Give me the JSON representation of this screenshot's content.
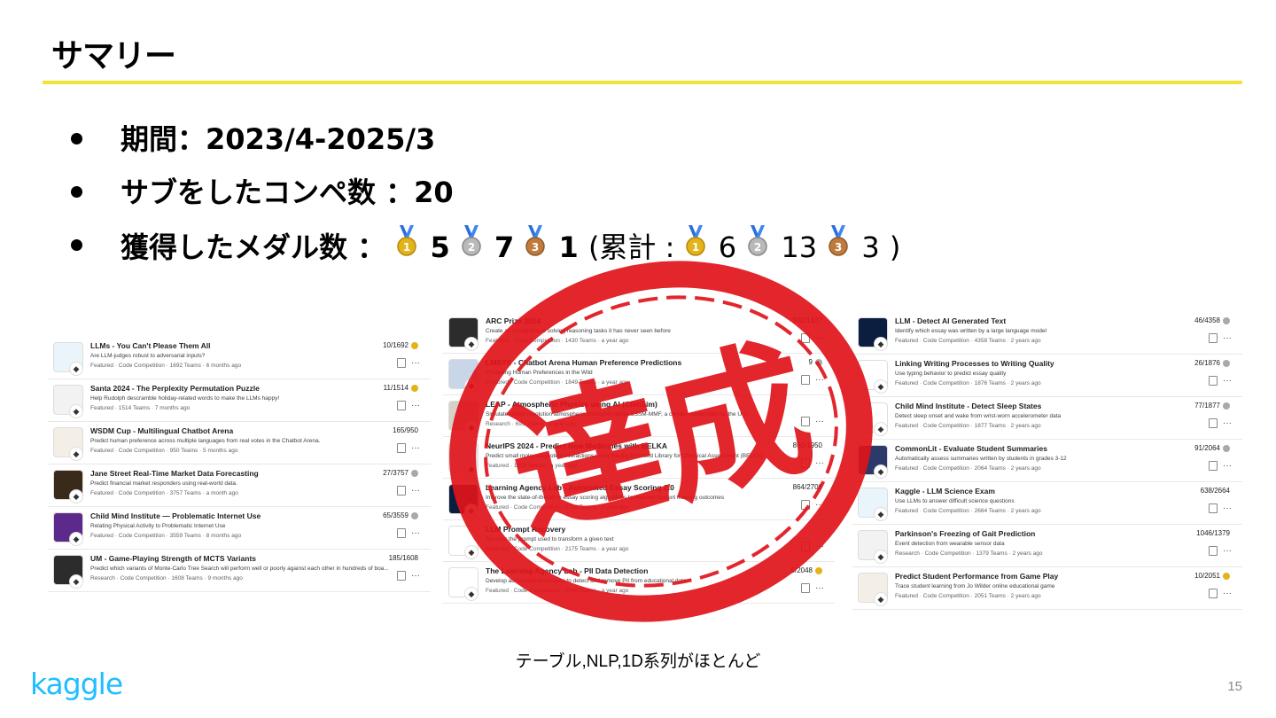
{
  "slide": {
    "title": "サマリー",
    "bullets": [
      {
        "label": "期間：2023/4-2025/3"
      },
      {
        "label": "サブをしたコンペ数 ：20"
      },
      {
        "label": "獲得したメダル数 ：",
        "gold": "5",
        "silver": "7",
        "bronze": "1",
        "total_prefix": "(累計 : ",
        "total_gold": "6",
        "total_silver": "13",
        "total_bronze": "3",
        "total_suffix": ")"
      }
    ],
    "caption": "テーブル,NLP,1D系列がほとんど",
    "logo": "kaggle",
    "page_number": "15",
    "stamp_text": "達成",
    "colors": {
      "accent_rule": "#f2e23a",
      "stamp": "#e0141b",
      "kaggle": "#20beff",
      "gold": "#e3b31a",
      "silver": "#a9a9a9",
      "bronze": "#c07b3c"
    }
  },
  "competitions": {
    "left": [
      {
        "title": "LLMs - You Can't Please Them All",
        "desc": "Are LLM-judges robust to adversarial inputs?",
        "meta": "Featured · Code Competition · 1692 Teams · 6 months ago",
        "rank": "10/1692",
        "medal": "gold",
        "icon": "game-image-icon"
      },
      {
        "title": "Santa 2024 - The Perplexity Permutation Puzzle",
        "desc": "Help Rudolph descramble holiday-related words to make the LLMs happy!",
        "meta": "Featured · 1514 Teams · 7 months ago",
        "rank": "11/1514",
        "medal": "gold",
        "icon": "santa-icon"
      },
      {
        "title": "WSDM Cup - Multilingual Chatbot Arena",
        "desc": "Predict human preference across multiple languages from real votes in the Chatbot Arena.",
        "meta": "Featured · Code Competition · 950 Teams · 5 months ago",
        "rank": "165/950",
        "medal": "",
        "icon": "chatbot-icon"
      },
      {
        "title": "Jane Street Real-Time Market Data Forecasting",
        "desc": "Predict financial market responders using real-world data.",
        "meta": "Featured · Code Competition · 3757 Teams · a month ago",
        "rank": "27/3757",
        "medal": "silver",
        "icon": "market-icon"
      },
      {
        "title": "Child Mind Institute — Problematic Internet Use",
        "desc": "Relating Physical Activity to Problematic Internet Use",
        "meta": "Featured · Code Competition · 3559 Teams · 8 months ago",
        "rank": "65/3559",
        "medal": "silver",
        "icon": "child-mind-icon"
      },
      {
        "title": "UM - Game-Playing Strength of MCTS Variants",
        "desc": "Predict which variants of Monte-Carlo Tree Search will perform well or poorly against each other in hundreds of boa...",
        "meta": "Research · Code Competition · 1608 Teams · 9 months ago",
        "rank": "185/1608",
        "medal": "",
        "icon": "um-icon"
      }
    ],
    "middle": [
      {
        "title": "ARC Prize 2024",
        "desc": "Create an AI capable of solving reasoning tasks it has never seen before",
        "meta": "Featured · Code Competition · 1430 Teams · a year ago",
        "rank": "502/1427",
        "medal": "",
        "icon": "arc-icon"
      },
      {
        "title": "LMSYS - Chatbot Arena Human Preference Predictions",
        "desc": "Predicting Human Preferences in the Wild",
        "meta": "Featured · Code Competition · 1849 Teams · a year ago",
        "rank": "9",
        "medal": "silver",
        "icon": "lmsys-icon"
      },
      {
        "title": "LEAP - Atmospheric Physics using AI (ClimSim)",
        "desc": "Simulate higher resolution atmospheric processes within E3SM-MMF, a climate model used by the U.S.",
        "meta": "Research · 693 Teams · a year ago",
        "rank": "",
        "medal": "",
        "icon": "leap-icon"
      },
      {
        "title": "NeurIPS 2024 - Predict New Medicines with BELKA",
        "desc": "Predict small molecule-protein interactions using the Big Encoded Library for Chemical Assessment (BELKA)",
        "meta": "Featured · 1950 Teams · a year ago",
        "rank": "890/1950",
        "medal": "",
        "icon": "belka-icon"
      },
      {
        "title": "Learning Agency Lab - Automated Essay Scoring 2.0",
        "desc": "Improve the state-of-the-art in essay scoring algorithms to improve student learning outcomes",
        "meta": "Featured · Code Competition · 2706 Teams · a year ago",
        "rank": "864/2706",
        "medal": "",
        "icon": "essay-icon"
      },
      {
        "title": "LLM Prompt Recovery",
        "desc": "Recover the prompt used to transform a given text",
        "meta": "Featured · Code Competition · 2175 Teams · a year ago",
        "rank": "",
        "medal": "",
        "icon": "sparkle-icon"
      },
      {
        "title": "The Learning Agency Lab - PII Data Detection",
        "desc": "Develop automated techniques to detect and remove PII from educational data",
        "meta": "Featured · Code Competition · 2048 Teams · a year ago",
        "rank": "5/2048",
        "medal": "gold",
        "icon": "pii-icon"
      }
    ],
    "right": [
      {
        "title": "LLM - Detect AI Generated Text",
        "desc": "Identify which essay was written by a large language model",
        "meta": "Featured · Code Competition · 4358 Teams · 2 years ago",
        "rank": "46/4358",
        "medal": "silver",
        "icon": "pen-icon"
      },
      {
        "title": "Linking Writing Processes to Writing Quality",
        "desc": "Use typing behavior to predict essay quality",
        "meta": "Featured · Code Competition · 1876 Teams · 2 years ago",
        "rank": "26/1876",
        "medal": "silver",
        "icon": "writing-icon"
      },
      {
        "title": "Child Mind Institute - Detect Sleep States",
        "desc": "Detect sleep onset and wake from wrist-worn accelerometer data",
        "meta": "Featured · Code Competition · 1877 Teams · 2 years ago",
        "rank": "77/1877",
        "medal": "silver",
        "icon": "sleep-icon"
      },
      {
        "title": "CommonLit - Evaluate Student Summaries",
        "desc": "Automatically assess summaries written by students in grades 3-12",
        "meta": "Featured · Code Competition · 2064 Teams · 2 years ago",
        "rank": "91/2064",
        "medal": "silver",
        "icon": "commonlit-icon"
      },
      {
        "title": "Kaggle - LLM Science Exam",
        "desc": "Use LLMs to answer difficult science questions",
        "meta": "Featured · Code Competition · 2664 Teams · 2 years ago",
        "rank": "638/2664",
        "medal": "",
        "icon": "abcd-icon"
      },
      {
        "title": "Parkinson's Freezing of Gait Prediction",
        "desc": "Event detection from wearable sensor data",
        "meta": "Research · Code Competition · 1379 Teams · 2 years ago",
        "rank": "1046/1379",
        "medal": "",
        "icon": "brain-icon"
      },
      {
        "title": "Predict Student Performance from Game Play",
        "desc": "Trace student learning from Jo Wilder online educational game",
        "meta": "Featured · Code Competition · 2051 Teams · 2 years ago",
        "rank": "10/2051",
        "medal": "gold",
        "icon": "game-play-icon"
      }
    ]
  }
}
